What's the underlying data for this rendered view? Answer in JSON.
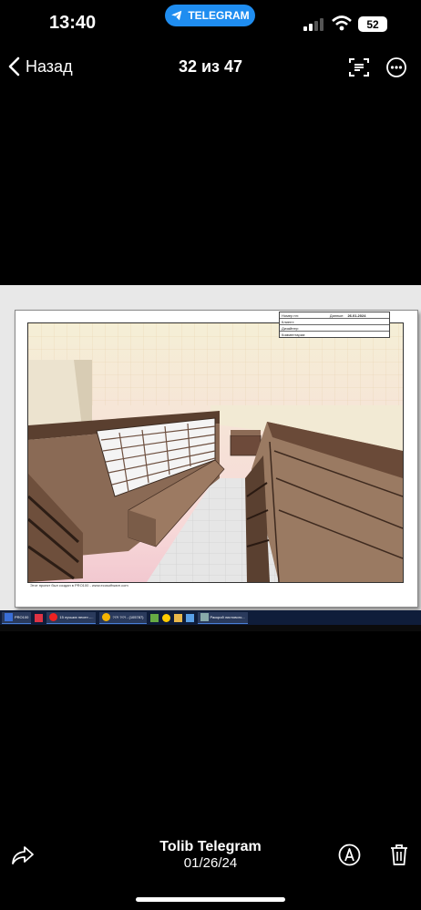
{
  "status_bar": {
    "time": "13:40",
    "pill_label": "TELEGRAM",
    "battery": "52"
  },
  "nav": {
    "back_label": "Назад",
    "counter": "32 из 47"
  },
  "photo": {
    "title_block": {
      "number_label": "Номер пп:",
      "date_label": "Данные:",
      "date_value": "26.01.2024",
      "client_label": "Клиент:",
      "designer_label": "Дизайнер:",
      "comments_label": "Комментарии:"
    },
    "footnote": "Этот проект был создан в PRO100 - www.ecosoftware.com",
    "taskbar": [
      {
        "label": "PRO100",
        "icon": "pro100-icon",
        "color": "#3a6fd8"
      },
      {
        "label": "",
        "icon": "pdf-app-icon",
        "color": "#d34"
      },
      {
        "label": "15 лучших песен -...",
        "icon": "opera-icon",
        "color": "#e22"
      },
      {
        "label": "?!?! ?!?! - (105787)",
        "icon": "chrome-icon",
        "color": "#f5b400"
      },
      {
        "label": "",
        "icon": "package-icon",
        "color": "#6a4"
      },
      {
        "label": "",
        "icon": "sun-icon",
        "color": "#fc0"
      },
      {
        "label": "",
        "icon": "folder-icon",
        "color": "#e9b84a"
      },
      {
        "label": "",
        "icon": "image-icon",
        "color": "#5aa0e6"
      },
      {
        "label": "Раскрой листового...",
        "icon": "document-icon",
        "color": "#8aa"
      }
    ]
  },
  "footer": {
    "sender": "Tolib Telegram",
    "date": "01/26/24"
  },
  "colors": {
    "telegram_blue": "#1f8df0",
    "background": "#000000"
  }
}
